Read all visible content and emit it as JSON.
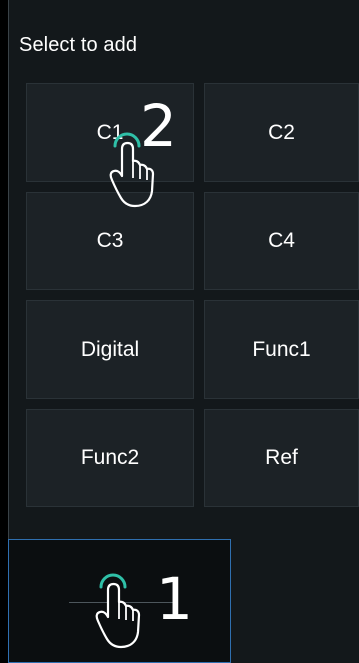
{
  "panel": {
    "header": "Select to add",
    "tiles": [
      {
        "label": "C1"
      },
      {
        "label": "C2"
      },
      {
        "label": "C3"
      },
      {
        "label": "C4"
      },
      {
        "label": "Digital"
      },
      {
        "label": "Func1"
      },
      {
        "label": "Func2"
      },
      {
        "label": "Ref"
      }
    ]
  },
  "annotations": {
    "step_top": "2",
    "step_bottom": "1",
    "icons": [
      "hand-pointer-icon",
      "touch-ripple-icon"
    ],
    "ripple_color": "#2fc0a8"
  },
  "colors": {
    "background": "#000000",
    "panel": "#13181b",
    "tile": "#1c2226",
    "slot_border": "#2f6fb0",
    "text": "#ffffff"
  }
}
